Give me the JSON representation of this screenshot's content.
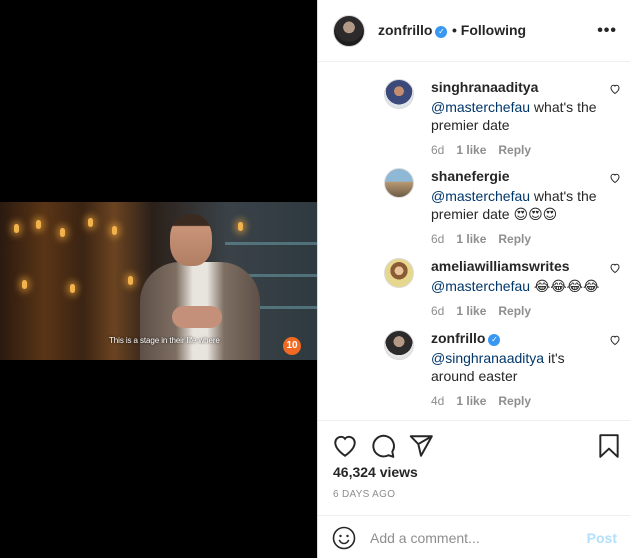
{
  "video": {
    "subtitle": "This is a stage in their life where",
    "channel_logo": "10"
  },
  "header": {
    "username": "zonfrillo",
    "follow_status": "• Following",
    "more_icon": "more-horizontal-icon"
  },
  "comments": [
    {
      "user": "singhranaaditya",
      "mention": "@masterchefau",
      "text": " what's the premier date",
      "time": "6d",
      "likes": "1 like",
      "reply": "Reply"
    },
    {
      "user": "shanefergie",
      "mention": "@masterchefau",
      "text": " what's the premier date 😍😍😍",
      "time": "6d",
      "likes": "1 like",
      "reply": "Reply"
    },
    {
      "user": "ameliawilliamswrites",
      "mention": "@masterchefau",
      "text": " 😂😂😂😂",
      "time": "6d",
      "likes": "1 like",
      "reply": "Reply"
    },
    {
      "user": "zonfrillo",
      "mention": "@singhranaaditya",
      "text": " it's around easter",
      "time": "4d",
      "likes": "1 like",
      "reply": "Reply",
      "verified": true
    }
  ],
  "actions": {
    "views": "46,324 views",
    "posted": "6 DAYS AGO"
  },
  "comment_box": {
    "placeholder": "Add a comment...",
    "post_label": "Post"
  },
  "colors": {
    "link": "#00376b",
    "verified": "#3897f0",
    "post_disabled": "#b2dffc",
    "meta": "#8e8e8e"
  }
}
